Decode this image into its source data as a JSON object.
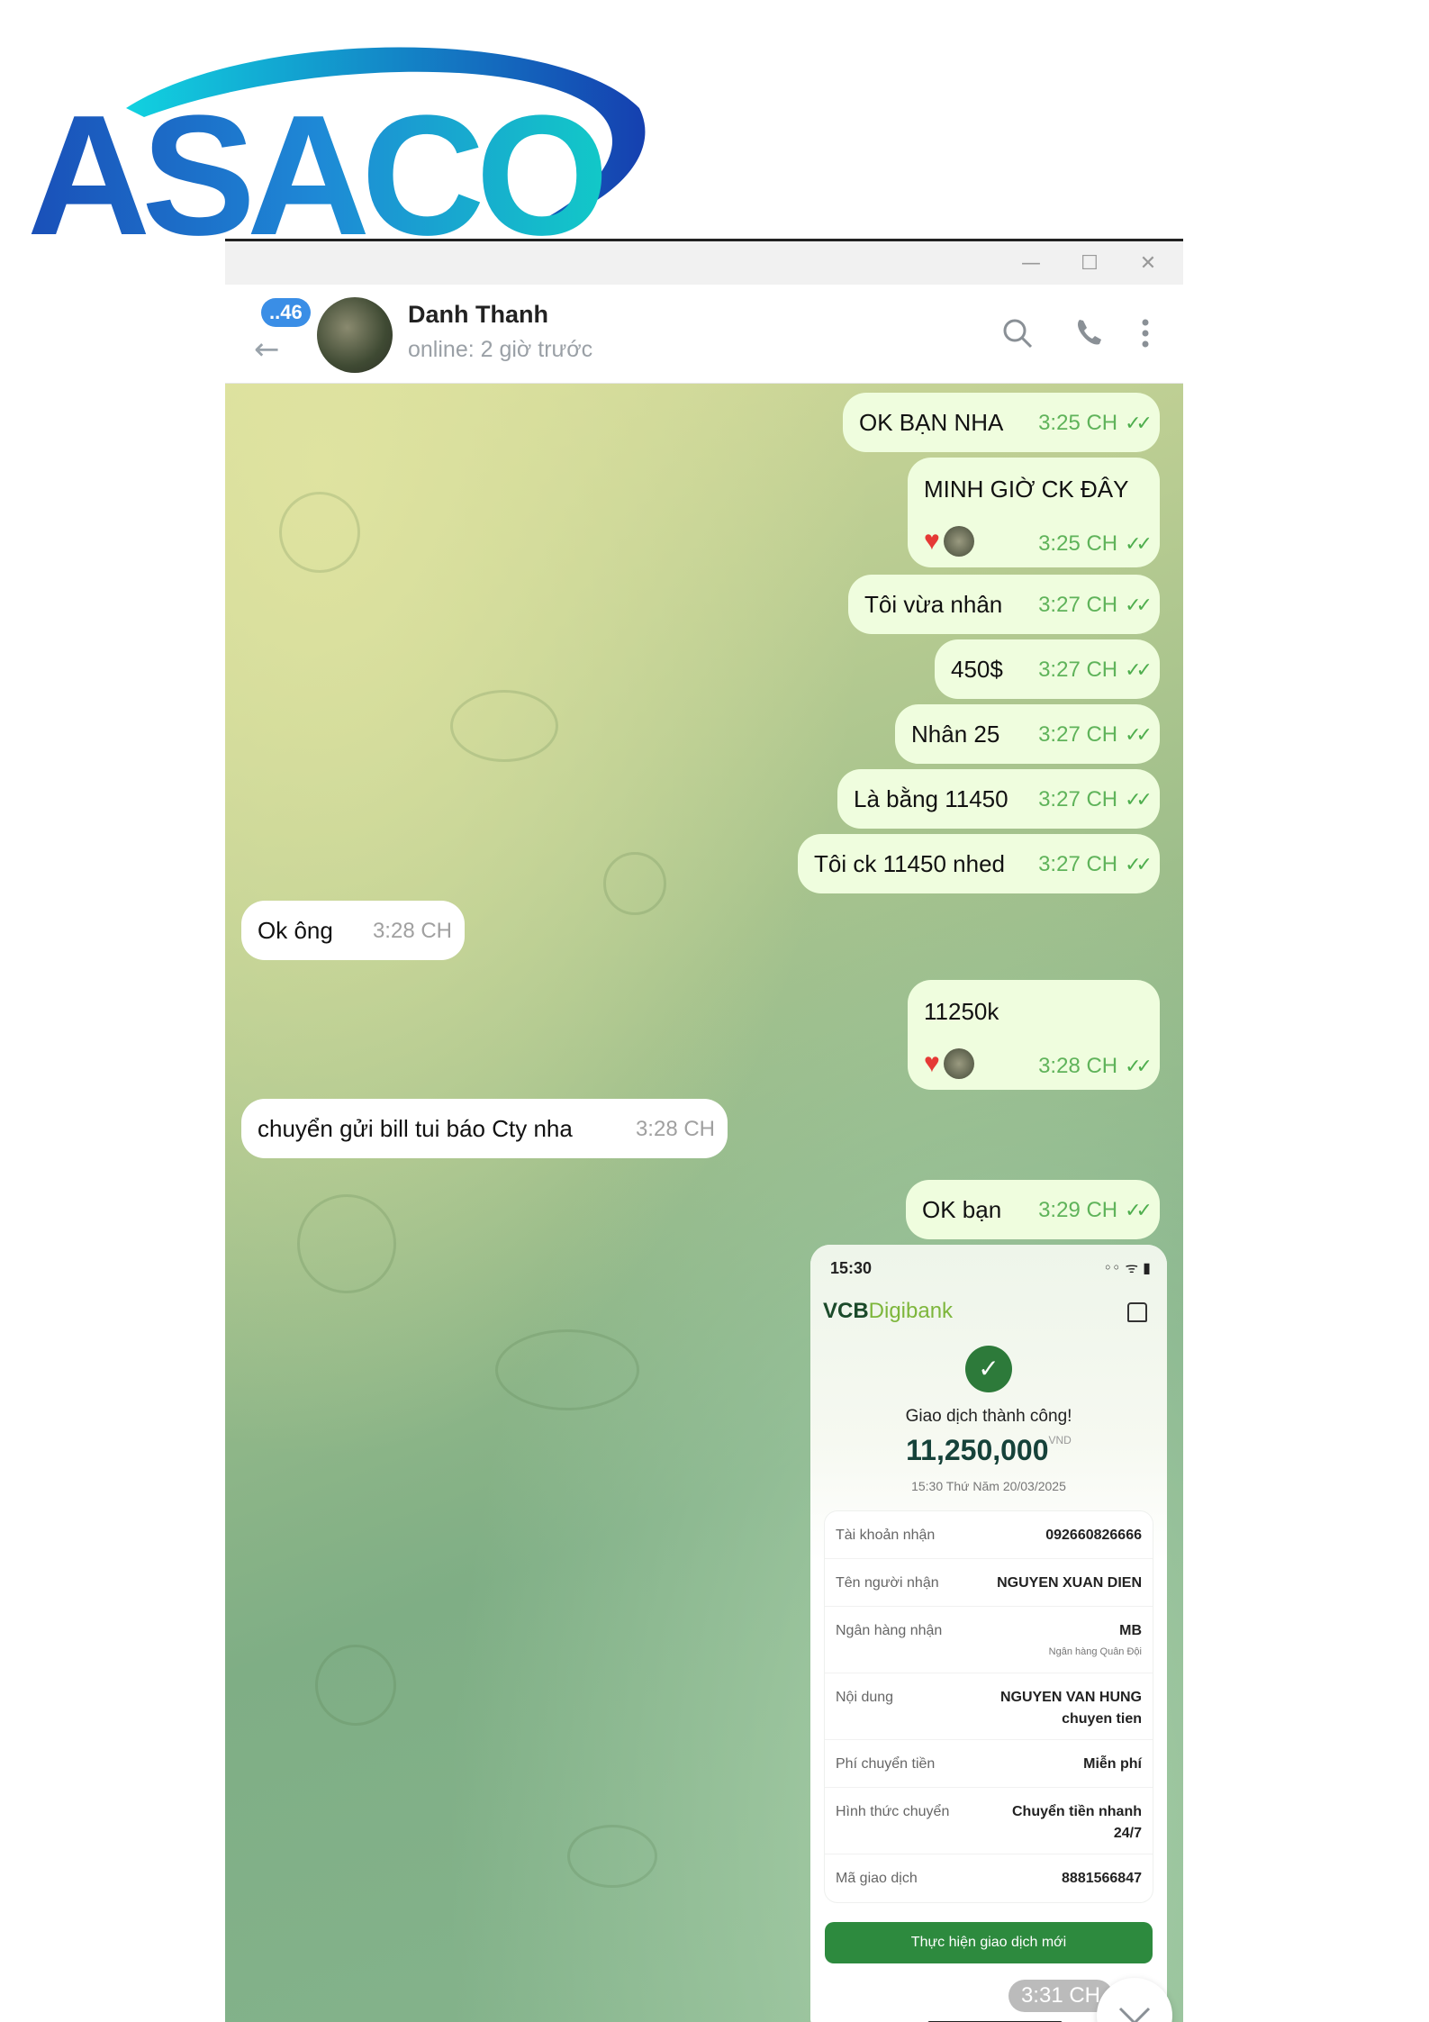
{
  "logo": {
    "text": "ASACO"
  },
  "window": {
    "minimize": "—",
    "maximize": "☐",
    "close": "✕"
  },
  "header": {
    "unread": "..46",
    "name": "Danh Thanh",
    "status": "online: 2 giờ trước",
    "icons": [
      "search-icon",
      "phone-icon",
      "more-vert-icon"
    ]
  },
  "messages": [
    {
      "side": "out",
      "text": "OK BẠN NHA",
      "time": "3:25 CH",
      "read": true
    },
    {
      "side": "out",
      "text": "MINH GIỜ CK ĐÂY",
      "time": "3:25 CH",
      "read": true,
      "reactions": [
        "heart",
        "avatar"
      ]
    },
    {
      "side": "out",
      "text": "Tôi vừa nhân",
      "time": "3:27 CH",
      "read": true
    },
    {
      "side": "out",
      "text": "450$",
      "time": "3:27 CH",
      "read": true
    },
    {
      "side": "out",
      "text": "Nhân 25",
      "time": "3:27 CH",
      "read": true
    },
    {
      "side": "out",
      "text": "Là bằng 11450",
      "time": "3:27 CH",
      "read": true
    },
    {
      "side": "out",
      "text": "Tôi ck 11450 nhed",
      "time": "3:27 CH",
      "read": true
    },
    {
      "side": "in",
      "text": "Ok ông",
      "time": "3:28 CH"
    },
    {
      "side": "out",
      "text": "11250k",
      "time": "3:28 CH",
      "read": true,
      "reactions": [
        "heart",
        "avatar"
      ]
    },
    {
      "side": "in",
      "text": "chuyển gửi bill tui báo Cty nha",
      "time": "3:28 CH"
    },
    {
      "side": "out",
      "text": "OK bạn",
      "time": "3:29 CH",
      "read": true
    }
  ],
  "receipt": {
    "phone_time": "15:30",
    "brand_vcb": "VCB",
    "brand_digibank": "Digibank",
    "success": "Giao dịch thành công!",
    "amount": "11,250,000",
    "currency": "VND",
    "datetime": "15:30 Thứ Năm 20/03/2025",
    "rows": [
      {
        "label": "Tài khoản nhận",
        "value": "092660826666"
      },
      {
        "label": "Tên người nhận",
        "value": "NGUYEN XUAN DIEN"
      },
      {
        "label": "Ngân hàng nhận",
        "value": "MB",
        "sub": "Ngân hàng Quân Đội"
      },
      {
        "label": "Nội dung",
        "value": "NGUYEN VAN HUNG",
        "value2": "chuyen tien"
      },
      {
        "label": "Phí chuyển tiền",
        "value": "Miễn phí"
      },
      {
        "label": "Hình thức chuyển",
        "value": "Chuyển tiền nhanh",
        "value2": "24/7"
      },
      {
        "label": "Mã giao dịch",
        "value": "8881566847"
      }
    ],
    "new_txn_button": "Thực hiện giao dịch mới",
    "time": "3:31 CH"
  }
}
